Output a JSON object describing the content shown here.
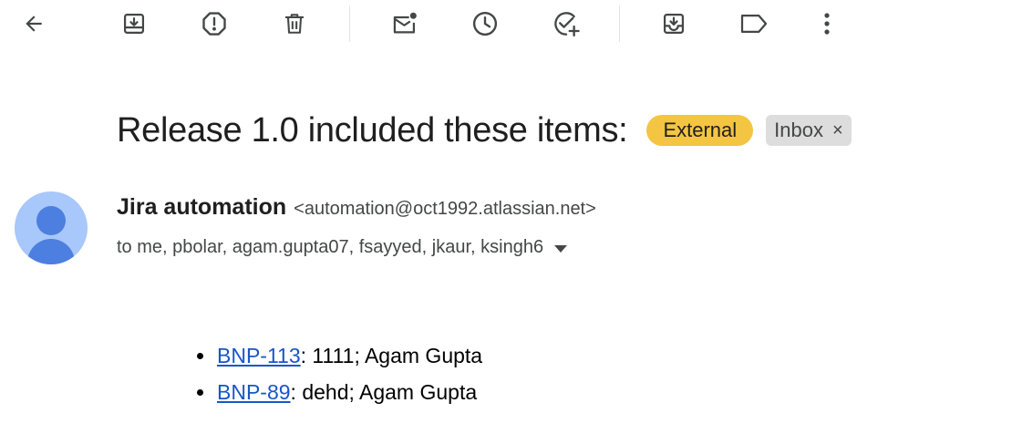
{
  "toolbar": {
    "buttons": [
      {
        "name": "back",
        "icon": "arrow-left-icon"
      },
      {
        "name": "archive",
        "icon": "archive-icon"
      },
      {
        "name": "report-spam",
        "icon": "report-spam-icon"
      },
      {
        "name": "delete",
        "icon": "trash-icon"
      },
      {
        "name": "mark-unread",
        "icon": "mark-unread-icon"
      },
      {
        "name": "snooze",
        "icon": "clock-icon"
      },
      {
        "name": "add-to-tasks",
        "icon": "add-task-icon"
      },
      {
        "name": "move-to",
        "icon": "move-to-inbox-icon"
      },
      {
        "name": "labels",
        "icon": "label-icon"
      },
      {
        "name": "more",
        "icon": "more-vert-icon"
      }
    ]
  },
  "subject": {
    "title": "Release 1.0 included these items:",
    "labels": {
      "external": "External",
      "inbox": "Inbox",
      "inbox_close": "×"
    }
  },
  "message": {
    "sender_name": "Jira automation",
    "sender_email": "<automation@oct1992.atlassian.net>",
    "recipients": "to me, pbolar, agam.gupta07, fsayyed, jkaur, ksingh6",
    "items": [
      {
        "key": "BNP-113",
        "text": ": 1111; Agam Gupta"
      },
      {
        "key": "BNP-89",
        "text": ": dehd; Agam Gupta"
      }
    ]
  },
  "colors": {
    "external_chip": "#f4c542",
    "inbox_chip": "#dddddd",
    "avatar_bg": "#a8c7fa",
    "avatar_fg": "#4d7fe0",
    "link": "#1a55c8",
    "icon": "#444746"
  }
}
